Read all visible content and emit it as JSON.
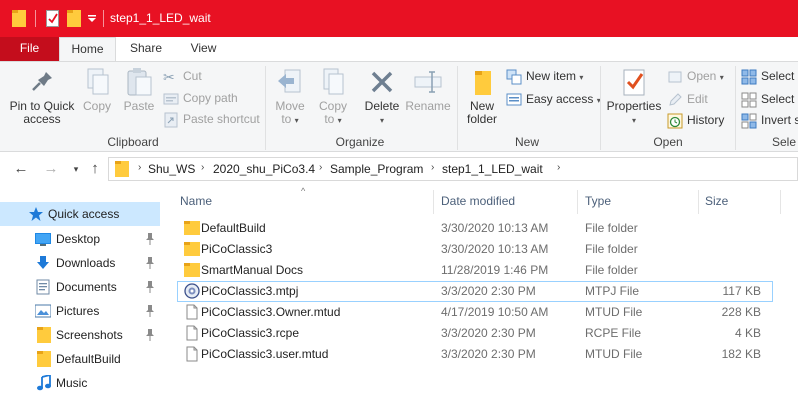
{
  "window": {
    "title": "step1_1_LED_wait"
  },
  "ribbon_tabs": {
    "file": "File",
    "home": "Home",
    "share": "Share",
    "view": "View"
  },
  "clipboard": {
    "pin": "Pin to Quick access",
    "copy": "Copy",
    "paste": "Paste",
    "cut": "Cut",
    "copy_path": "Copy path",
    "paste_shortcut": "Paste shortcut",
    "group": "Clipboard"
  },
  "organize": {
    "move_to": "Move",
    "move_to_2": "to",
    "copy_to": "Copy",
    "copy_to_2": "to",
    "delete": "Delete",
    "rename": "Rename",
    "group": "Organize"
  },
  "new": {
    "new_folder": "New",
    "new_folder_2": "folder",
    "new_item": "New item",
    "easy_access": "Easy access",
    "group": "New"
  },
  "open": {
    "properties": "Properties",
    "open": "Open",
    "edit": "Edit",
    "history": "History",
    "group": "Open"
  },
  "select": {
    "select_all": "Select a",
    "select_none": "Select n",
    "invert": "Invert s",
    "group": "Sele"
  },
  "address": {
    "crumbs": [
      "Shu_WS",
      "2020_shu_PiCo3.4",
      "Sample_Program",
      "step1_1_LED_wait"
    ]
  },
  "sidebar": {
    "items": [
      {
        "label": "Quick access",
        "icon": "star-icon",
        "selected": true
      },
      {
        "label": "Desktop",
        "icon": "desktop-icon",
        "pinned": true
      },
      {
        "label": "Downloads",
        "icon": "download-icon",
        "pinned": true
      },
      {
        "label": "Documents",
        "icon": "documents-icon",
        "pinned": true
      },
      {
        "label": "Pictures",
        "icon": "pictures-icon",
        "pinned": true
      },
      {
        "label": "Screenshots",
        "icon": "folder-icon",
        "pinned": true
      },
      {
        "label": "DefaultBuild",
        "icon": "folder-icon"
      },
      {
        "label": "Music",
        "icon": "music-icon"
      }
    ]
  },
  "columns": {
    "name": "Name",
    "date": "Date modified",
    "type": "Type",
    "size": "Size"
  },
  "files": [
    {
      "name": "DefaultBuild",
      "date": "3/30/2020 10:13 AM",
      "type": "File folder",
      "size": "",
      "icon": "folder-icon"
    },
    {
      "name": "PiCoClassic3",
      "date": "3/30/2020 10:13 AM",
      "type": "File folder",
      "size": "",
      "icon": "folder-icon"
    },
    {
      "name": "SmartManual Docs",
      "date": "11/28/2019 1:46 PM",
      "type": "File folder",
      "size": "",
      "icon": "folder-icon"
    },
    {
      "name": "PiCoClassic3.mtpj",
      "date": "3/3/2020 2:30 PM",
      "type": "MTPJ File",
      "size": "117 KB",
      "icon": "project-file-icon",
      "focused": true
    },
    {
      "name": "PiCoClassic3.Owner.mtud",
      "date": "4/17/2019 10:50 AM",
      "type": "MTUD File",
      "size": "228 KB",
      "icon": "file-icon"
    },
    {
      "name": "PiCoClassic3.rcpe",
      "date": "3/3/2020 2:30 PM",
      "type": "RCPE File",
      "size": "4 KB",
      "icon": "file-icon"
    },
    {
      "name": "PiCoClassic3.user.mtud",
      "date": "3/3/2020 2:30 PM",
      "type": "MTUD File",
      "size": "182 KB",
      "icon": "file-icon"
    }
  ],
  "colors": {
    "titlebar": "#e81123",
    "file_tab": "#c40d1c",
    "selection": "#cce8ff",
    "focus_border": "#99d1ff",
    "folder": "#ffcb3d",
    "accent_blue": "#1e7ad8"
  }
}
